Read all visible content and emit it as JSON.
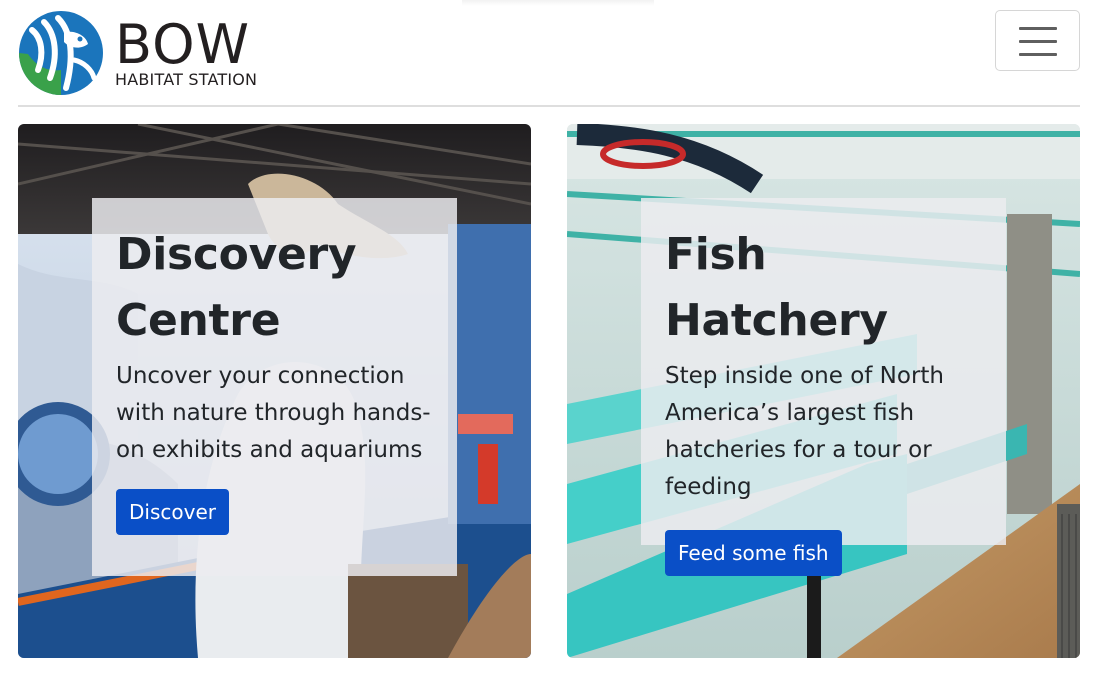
{
  "header": {
    "logo_word": "BOW",
    "logo_sub": "HABITAT STATION",
    "menu_icon": "hamburger-menu-icon"
  },
  "cards": [
    {
      "title": "Discovery Centre",
      "description": "Uncover your connection with nature through hands-on exhibits and aquariums",
      "button_label": "Discover"
    },
    {
      "title": "Fish Hatchery",
      "description": "Step inside one of North America’s largest fish hatcheries for a tour or feeding",
      "button_label": "Feed some fish"
    }
  ],
  "colors": {
    "button": "#0a4fc7",
    "logo_blue": "#1b75bc",
    "logo_green": "#3aa14a"
  }
}
